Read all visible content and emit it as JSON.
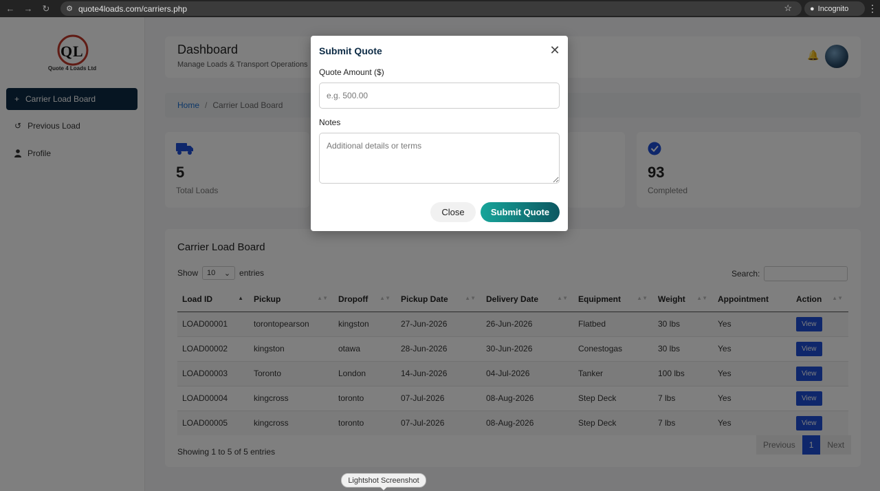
{
  "browser": {
    "url": "quote4loads.com/carriers.php",
    "incognito_label": "Incognito"
  },
  "sidebar": {
    "logo_text": "Quote 4 Loads Ltd",
    "items": [
      {
        "label": "Carrier Load Board",
        "icon": "plus-icon",
        "active": true
      },
      {
        "label": "Previous Load",
        "icon": "history-icon",
        "active": false
      },
      {
        "label": "Profile",
        "icon": "user-icon",
        "active": false
      }
    ]
  },
  "header": {
    "title": "Dashboard",
    "subtitle": "Manage Loads & Transport Operations"
  },
  "breadcrumb": {
    "home": "Home",
    "separator": "/",
    "current": "Carrier Load Board"
  },
  "stats": [
    {
      "value": "5",
      "label": "Total Loads",
      "icon": "truck-icon"
    },
    {
      "value": "93",
      "label": "Completed",
      "icon": "check-circle-icon"
    }
  ],
  "board": {
    "title": "Carrier Load Board",
    "show_label": "Show",
    "entries_count": "10",
    "entries_label": "entries",
    "search_label": "Search:",
    "columns": [
      "Load ID",
      "Pickup",
      "Dropoff",
      "Pickup Date",
      "Delivery Date",
      "Equipment",
      "Weight",
      "Appointment",
      "Action"
    ],
    "rows": [
      [
        "LOAD00001",
        "torontopearson",
        "kingston",
        "27-Jun-2026",
        "26-Jun-2026",
        "Flatbed",
        "30 lbs",
        "Yes",
        "View"
      ],
      [
        "LOAD00002",
        "kingston",
        "otawa",
        "28-Jun-2026",
        "30-Jun-2026",
        "Conestogas",
        "30 lbs",
        "Yes",
        "View"
      ],
      [
        "LOAD00003",
        "Toronto",
        "London",
        "14-Jun-2026",
        "04-Jul-2026",
        "Tanker",
        "100 lbs",
        "Yes",
        "View"
      ],
      [
        "LOAD00004",
        "kingcross",
        "toronto",
        "07-Jul-2026",
        "08-Aug-2026",
        "Step Deck",
        "7 lbs",
        "Yes",
        "View"
      ],
      [
        "LOAD00005",
        "kingcross",
        "toronto",
        "07-Jul-2026",
        "08-Aug-2026",
        "Step Deck",
        "7 lbs",
        "Yes",
        "View"
      ]
    ],
    "info": "Showing 1 to 5 of 5 entries",
    "pager": {
      "previous": "Previous",
      "page": "1",
      "next": "Next"
    }
  },
  "modal": {
    "title": "Submit Quote",
    "amount_label": "Quote Amount ($)",
    "amount_placeholder": "e.g. 500.00",
    "notes_label": "Notes",
    "notes_placeholder": "Additional details or terms",
    "close_label": "Close",
    "submit_label": "Submit Quote"
  },
  "tooltip": "Lightshot Screenshot",
  "colors": {
    "sidebar_active": "#0d2b45",
    "link": "#1a6fd1",
    "view_button": "#1e4fd6",
    "submit_gradient_start": "#17a59a",
    "submit_gradient_end": "#0c5761"
  }
}
